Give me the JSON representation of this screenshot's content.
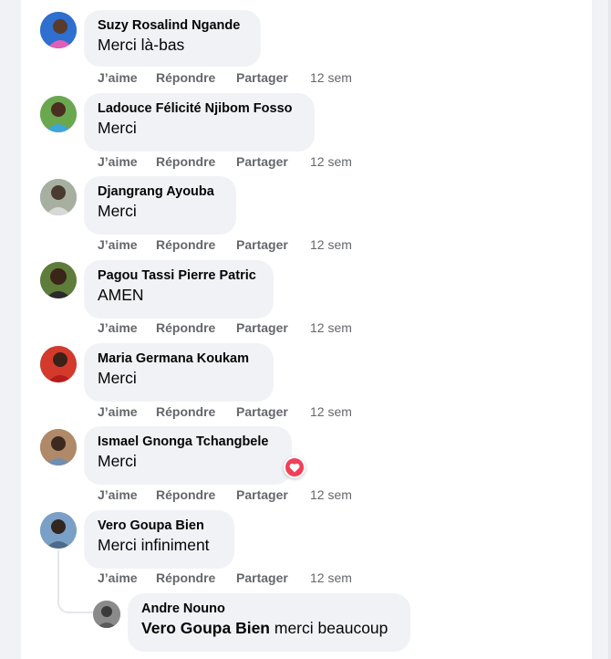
{
  "actions": {
    "like_label": "J’aime",
    "reply_label": "Répondre",
    "share_label": "Partager"
  },
  "comments": [
    {
      "author": "Suzy Rosalind Ngande",
      "text": "Merci là-bas",
      "time": "12 sem"
    },
    {
      "author": "Ladouce Félicité Njibom Fosso",
      "text": "Merci",
      "time": "12 sem"
    },
    {
      "author": "Djangrang Ayouba",
      "text": "Merci",
      "time": "12 sem"
    },
    {
      "author": "Pagou Tassi Pierre Patric",
      "text": "AMEN",
      "time": "12 sem"
    },
    {
      "author": "Maria Germana Koukam",
      "text": "Merci",
      "time": "12 sem"
    },
    {
      "author": "Ismael Gnonga Tchangbele",
      "text": "Merci",
      "time": "12 sem",
      "reaction": "love-icon"
    },
    {
      "author": "Vero Goupa Bien",
      "text": "Merci infiniment",
      "time": "12 sem"
    }
  ],
  "reply": {
    "author": "Andre Nouno",
    "mention": "Vero Goupa Bien",
    "text": "merci beaucoup"
  },
  "colors": {
    "bubble": "#f0f2f5",
    "action_text": "#65676b",
    "love_reaction": "#f33e58"
  }
}
